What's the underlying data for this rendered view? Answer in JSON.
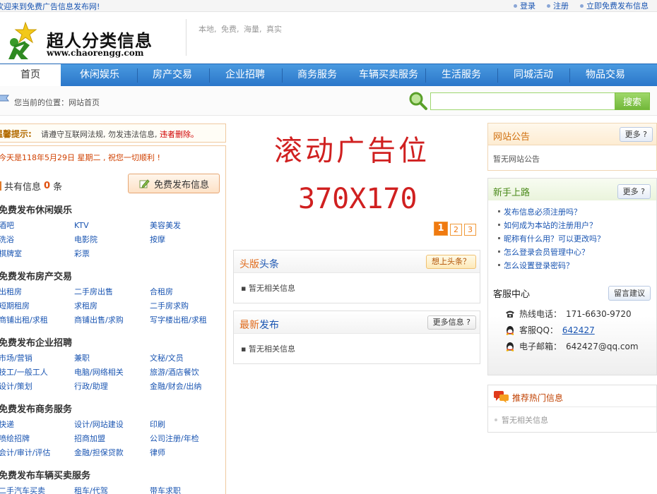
{
  "topbar": {
    "welcome": "欢迎来到免费广告信息发布网!",
    "links": [
      "登录",
      "注册",
      "立即免费发布信息"
    ]
  },
  "header": {
    "logo_name": "超人分类信息",
    "logo_url": "www.chaorengg.com",
    "slogan": "本地, 免费, 海量, 真实"
  },
  "nav": {
    "items": [
      "首页",
      "休闲娱乐",
      "房产交易",
      "企业招聘",
      "商务服务",
      "车辆买卖服务",
      "生活服务",
      "同城活动",
      "物品交易"
    ],
    "active_index": 0
  },
  "location": {
    "text": "您当前的位置：网站首页"
  },
  "search": {
    "value": "",
    "button": "搜索"
  },
  "notice": {
    "label": "温馨提示:",
    "text": "请遵守互联网法规, 勿发违法信息,",
    "warn": "违者删除。"
  },
  "left": {
    "date": "今天是118年5月29日 星期二 , 祝您一切顺利 !",
    "count_prefix": "共有信息",
    "count": "0",
    "count_suffix": "条",
    "publish_button": "免费发布信息",
    "categories": [
      {
        "title": "免费发布休闲娱乐",
        "items": [
          "酒吧",
          "KTV",
          "美容美发",
          "洗浴",
          "电影院",
          "按摩",
          "棋牌室",
          "彩票"
        ]
      },
      {
        "title": "免费发布房产交易",
        "items": [
          "出租房",
          "二手房出售",
          "合租房",
          "短期租房",
          "求租房",
          "二手房求购",
          "商铺出租/求租",
          "商铺出售/求购",
          "写字楼出租/求租"
        ]
      },
      {
        "title": "免费发布企业招聘",
        "items": [
          "市场/营销",
          "兼职",
          "文秘/文员",
          "技工/一般工人",
          "电脑/网络相关",
          "旅游/酒店餐饮",
          "设计/策划",
          "行政/助理",
          "金融/财会/出纳"
        ]
      },
      {
        "title": "免费发布商务服务",
        "items": [
          "快递",
          "设计/网站建设",
          "印刷",
          "喷绘招牌",
          "招商加盟",
          "公司注册/年检",
          "会计/审计/评估",
          "金融/担保贷款",
          "律师"
        ]
      },
      {
        "title": "免费发布车辆买卖服务",
        "items": [
          "二手汽车买卖",
          "租车/代驾",
          "带车求职"
        ]
      }
    ]
  },
  "ad": {
    "title": "滚动广告位",
    "size": "370X170",
    "pages": [
      "1",
      "2",
      "3"
    ],
    "active_page": 0
  },
  "headline": {
    "title_a": "头版",
    "title_b": "头条",
    "button": "想上头条？",
    "empty": "暂无相关信息"
  },
  "latest": {
    "title_a": "最新",
    "title_b": "发布",
    "button": "更多信息 ?",
    "empty": "暂无相关信息"
  },
  "site_notice": {
    "title": "网站公告",
    "button": "更多 ?",
    "empty": "暂无网站公告"
  },
  "guide": {
    "title": "新手上路",
    "button": "更多 ?",
    "items": [
      "发布信息必须注册吗？",
      "如何成为本站的注册用户？",
      "昵称有什么用？可以更改吗？",
      "怎么登录会员管理中心？",
      "怎么设置登录密码？"
    ]
  },
  "service": {
    "title": "客服中心",
    "button": "留言建议",
    "phone_label": "热线电话：",
    "phone": "171-6630-9720",
    "qq_label": "客服QQ：",
    "qq": "642427",
    "email_label": "电子邮箱：",
    "email": "642427@qq.com"
  },
  "hot": {
    "title": "推荐热门信息",
    "empty": "暂无相关信息"
  },
  "colors": {
    "nav_blue": "#2b76c9",
    "accent_orange": "#e06a1a",
    "link_blue": "#1a55b2",
    "ad_red": "#d02020",
    "search_green": "#72b83a"
  }
}
